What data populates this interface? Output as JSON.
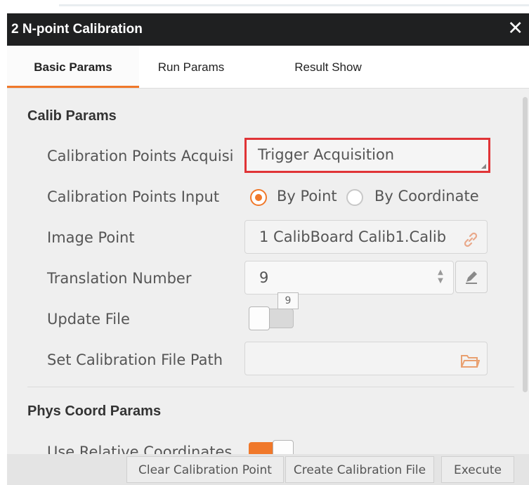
{
  "window": {
    "title": "2 N-point Calibration",
    "close_icon": "close-icon"
  },
  "tabs": [
    {
      "label": "Basic Params",
      "active": true
    },
    {
      "label": "Run Params",
      "active": false
    },
    {
      "label": "Result Show",
      "active": false
    }
  ],
  "calib_params": {
    "section_title": "Calib Params",
    "acquisition": {
      "label": "Calibration Points Acquisi",
      "value": "Trigger Acquisition"
    },
    "points_input": {
      "label": "Calibration Points Input",
      "options": [
        {
          "label": "By Point",
          "selected": true
        },
        {
          "label": "By Coordinate",
          "selected": false
        }
      ]
    },
    "image_point": {
      "label": "Image Point",
      "value": "1 CalibBoard Calib1.Calib",
      "icon": "link-icon"
    },
    "translation_number": {
      "label": "Translation Number",
      "value": "9",
      "tooltip": "9",
      "icon": "pencil-icon"
    },
    "update_file": {
      "label": "Update File",
      "enabled": false
    },
    "file_path": {
      "label": "Set Calibration File Path",
      "value": "",
      "icon": "folder-icon"
    }
  },
  "phys_coord_params": {
    "section_title": "Phys Coord Params",
    "relative_coords": {
      "label": "Use Relative Coordinates",
      "enabled": true
    }
  },
  "footer": {
    "buttons": [
      {
        "label": "Clear Calibration Point"
      },
      {
        "label": "Create Calibration File"
      },
      {
        "label": "Execute"
      }
    ]
  },
  "colors": {
    "accent": "#f0782a",
    "titlebar": "#1f2021",
    "highlight_border": "#e03437"
  }
}
